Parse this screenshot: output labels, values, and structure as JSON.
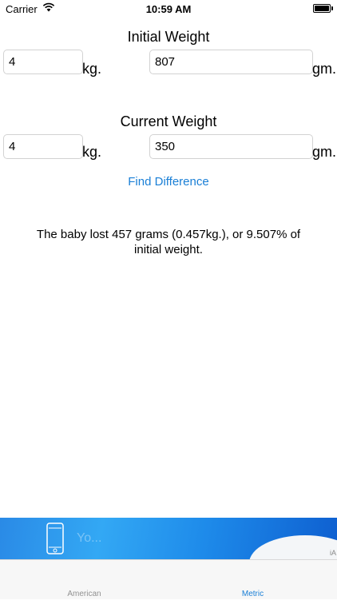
{
  "status_bar": {
    "carrier": "Carrier",
    "time": "10:59 AM",
    "battery_level": 1.0
  },
  "initial_weight": {
    "title": "Initial Weight",
    "kg_value": "4",
    "kg_unit": "kg.",
    "gm_value": "807",
    "gm_unit": "gm."
  },
  "current_weight": {
    "title": "Current Weight",
    "kg_value": "4",
    "kg_unit": "kg.",
    "gm_value": "350",
    "gm_unit": "gm."
  },
  "find_button_label": "Find Difference",
  "result_text": "The baby lost 457 grams (0.457kg.), or 9.507% of initial weight.",
  "ad": {
    "text": "Yo...",
    "mark": "iA"
  },
  "tabs": [
    {
      "label": "American",
      "selected": false
    },
    {
      "label": "Metric",
      "selected": true
    }
  ],
  "colors": {
    "accent": "#1a7fd6",
    "tab_inactive": "#929292"
  }
}
